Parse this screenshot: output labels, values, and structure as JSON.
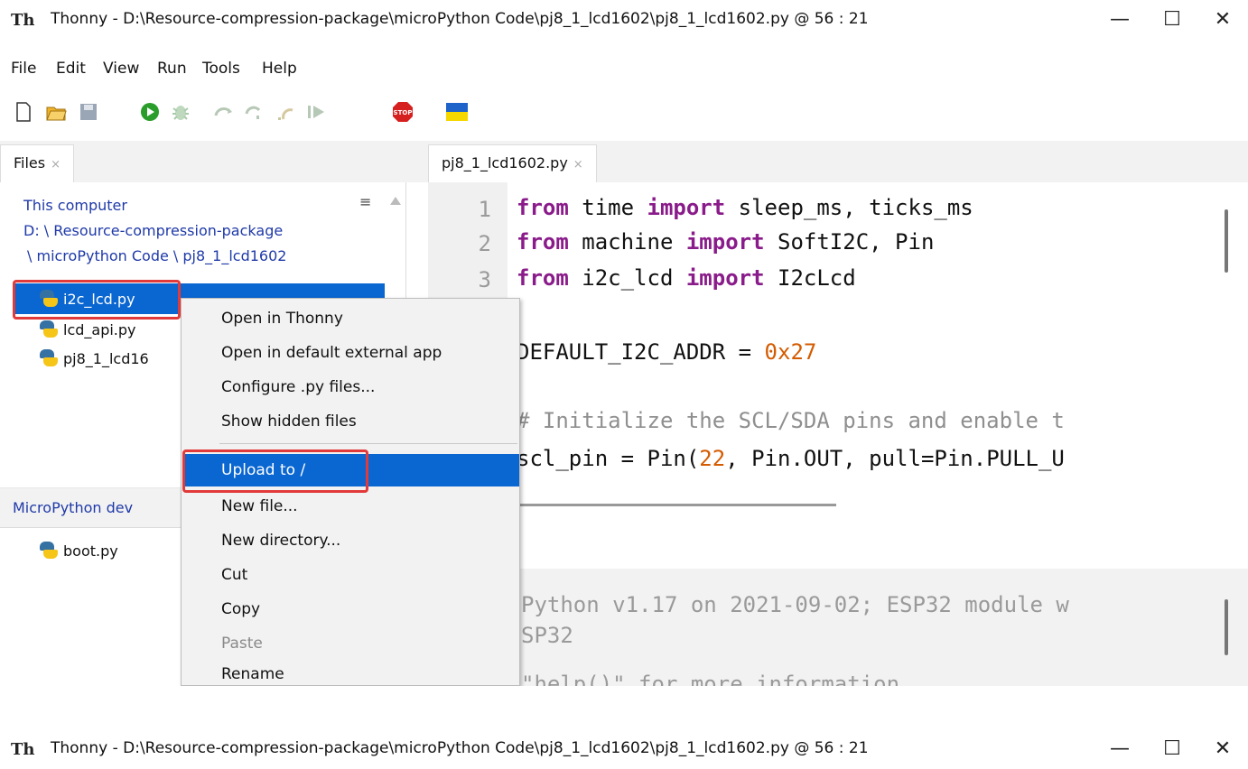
{
  "window": {
    "title": "Thonny  -  D:\\Resource-compression-package\\microPython Code\\pj8_1_lcd1602\\pj8_1_lcd1602.py  @  56 : 21",
    "minimize_glyph": "—",
    "maximize_glyph": "☐",
    "close_glyph": "✕"
  },
  "menu": [
    "File",
    "Edit",
    "View",
    "Run",
    "Tools",
    "Help"
  ],
  "toolbar": {
    "icons": [
      "new-file-icon",
      "open-file-icon",
      "save-icon",
      "run-icon",
      "debug-icon",
      "step-over-icon",
      "step-into-icon",
      "step-out-icon",
      "resume-icon",
      "stop-icon",
      "ukraine-flag-icon"
    ],
    "stop_label": "STOP"
  },
  "files_panel": {
    "tab_label": "Files",
    "tab_close": "×",
    "menu_glyph": "≡",
    "location_heading": "This computer",
    "path_line1": "D: \\ Resource-compression-package",
    "path_line2": "\\ microPython Code \\ pj8_1_lcd1602",
    "items": [
      "i2c_lcd.py",
      "lcd_api.py",
      "pj8_1_lcd16"
    ]
  },
  "device_panel": {
    "tab_label": "MicroPython dev",
    "items": [
      "boot.py"
    ]
  },
  "editor": {
    "tab_label": "pj8_1_lcd1602.py",
    "tab_close": "×",
    "line_numbers": [
      "1",
      "2",
      "3"
    ],
    "lines": [
      {
        "a": "from",
        "b": " time ",
        "c": "import",
        "d": " sleep_ms, ticks_ms"
      },
      {
        "a": "from",
        "b": " machine ",
        "c": "import",
        "d": " SoftI2C, Pin"
      },
      {
        "a": "from",
        "b": " i2c_lcd ",
        "c": "import",
        "d": " I2cLcd"
      }
    ],
    "addr_prefix": "DEFAULT_I2C_ADDR = ",
    "addr_value": "0x27",
    "comment": "# Initialize the SCL/SDA pins and enable t",
    "scl_prefix": "scl_pin = Pin(",
    "scl_num": "22",
    "scl_suffix": ", Pin.OUT, pull=Pin.PULL_U"
  },
  "shell": {
    "line1": "Python v1.17 on 2021-09-02; ESP32 module w",
    "line2": "SP32",
    "line3": "\"help()\" for more information."
  },
  "context_menu": {
    "items": [
      {
        "label": "Open in Thonny",
        "enabled": true
      },
      {
        "label": "Open in default external app",
        "enabled": true
      },
      {
        "label": "Configure .py files...",
        "enabled": true
      },
      {
        "label": "Show hidden files",
        "enabled": true
      },
      {
        "label": "Upload to /",
        "enabled": true,
        "highlighted": true
      },
      {
        "label": "New file...",
        "enabled": true
      },
      {
        "label": "New directory...",
        "enabled": true
      },
      {
        "label": "Cut",
        "enabled": true
      },
      {
        "label": "Copy",
        "enabled": true
      },
      {
        "label": "Paste",
        "enabled": false
      },
      {
        "label": "Rename",
        "enabled": true
      }
    ]
  },
  "colors": {
    "selection": "#0a66d1",
    "highlight_box": "#e23a3a",
    "keyword": "#8a1b8a",
    "number": "#d45b00"
  }
}
